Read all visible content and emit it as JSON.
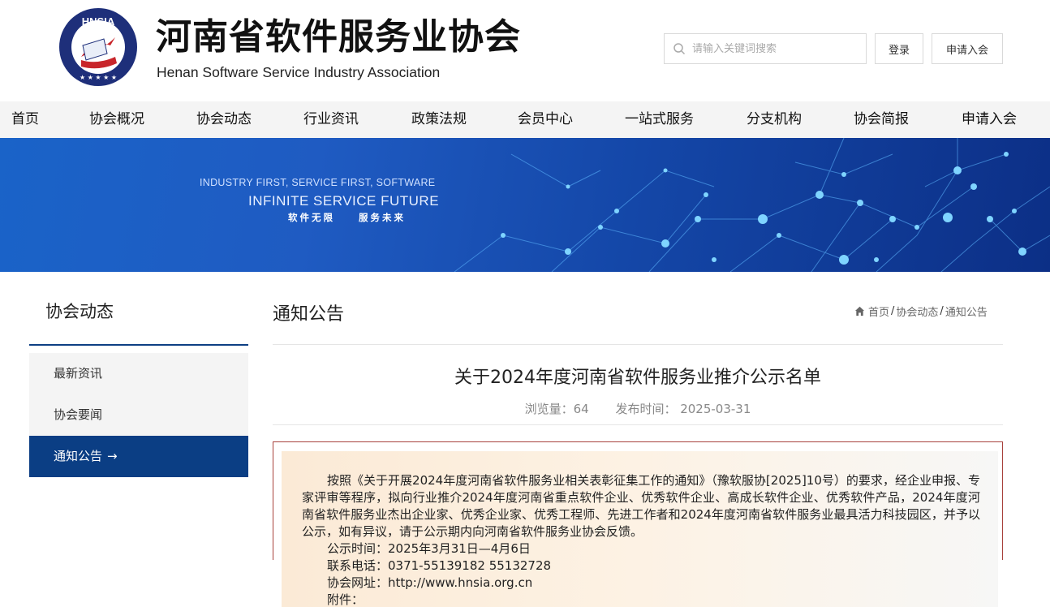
{
  "header": {
    "logo_text": "HNSIA",
    "title_cn": "河南省软件服务业协会",
    "title_en": "Henan Software Service Industry Association",
    "search_placeholder": "请输入关键词搜索",
    "login_label": "登录",
    "join_label": "申请入会"
  },
  "nav": {
    "items": [
      {
        "label": "首页"
      },
      {
        "label": "协会概况"
      },
      {
        "label": "协会动态"
      },
      {
        "label": "行业资讯"
      },
      {
        "label": "政策法规"
      },
      {
        "label": "会员中心"
      },
      {
        "label": "一站式服务"
      },
      {
        "label": "分支机构"
      },
      {
        "label": "协会简报"
      },
      {
        "label": "申请入会"
      }
    ]
  },
  "banner": {
    "line1": "INDUSTRY FIRST, SERVICE FIRST, SOFTWARE",
    "line2": "INFINITE SERVICE FUTURE",
    "line3": "软件无限　　服务未来"
  },
  "sidebar": {
    "title": "协会动态",
    "items": [
      {
        "label": "最新资讯",
        "active": false
      },
      {
        "label": "协会要闻",
        "active": false
      },
      {
        "label": "通知公告",
        "active": true
      }
    ],
    "active_arrow": "→"
  },
  "main": {
    "section_title": "通知公告",
    "breadcrumb": [
      "首页",
      "协会动态",
      "通知公告"
    ],
    "breadcrumb_sep": "/",
    "article_title": "关于2024年度河南省软件服务业推介公示名单",
    "views_label": "浏览量：64",
    "publish_label": "发布时间：  2025-03-31",
    "body_paragraph": "按照《关于开展2024年度河南省软件服务业相关表彰征集工作的通知》（豫软服协[2025]10号）的要求，经企业申报、专家评审等程序，拟向行业推介2024年度河南省重点软件企业、优秀软件企业、高成长软件企业、优秀软件产品，2024年度河南省软件服务业杰出企业家、优秀企业家、优秀工程师、先进工作者和2024年度河南省软件服务业最具活力科技园区，并予以公示，如有异议，请于公示期内向河南省软件服务业协会反馈。",
    "lines": [
      "公示时间：2025年3月31日—4月6日",
      "联系电话：0371-55139182  55132728",
      "协会网址：http://www.hnsia.org.cn",
      "附件："
    ]
  },
  "colors": {
    "nav_bg": "#f4f4f4",
    "sidebar_active": "#0b3e84",
    "content_border": "#a8413c",
    "logo_blue": "#1e2f7a",
    "logo_red": "#c8262b"
  }
}
